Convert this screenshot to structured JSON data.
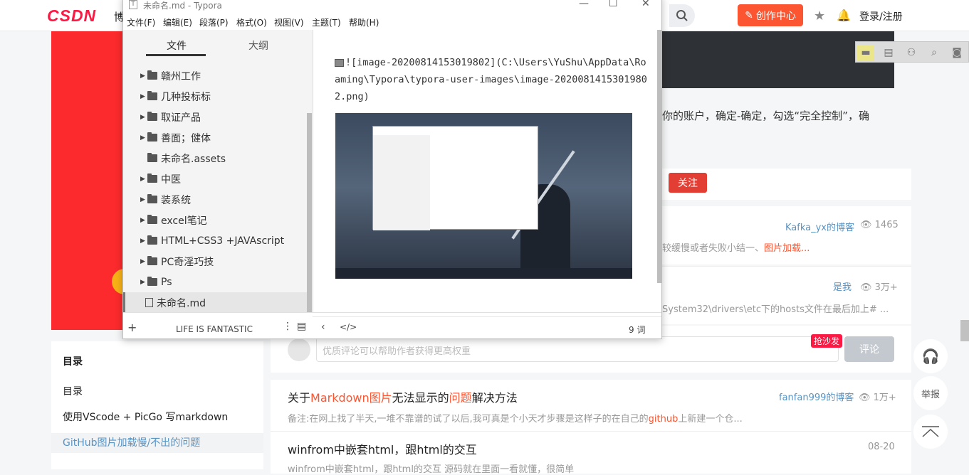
{
  "csdn": {
    "logo": "CSDN",
    "nav_partial": "博",
    "create_label": "创作中心",
    "login_label": "登录/注册"
  },
  "article": {
    "text_partial": "你的账户，确定-确定，勾选“完全控制”，确",
    "follow_label": "关注"
  },
  "recommendations": [
    {
      "blog": "Kafka_yx的博客",
      "views": "1465",
      "desc_plain": "较缓慢或者失败小结一、",
      "desc_red": "图片加载..."
    },
    {
      "blog": "是我",
      "views": "3万+",
      "desc_plain": "System32\\drivers\\etc下的hosts文件在最后加上# ..."
    },
    {
      "title_parts": [
        "关于",
        "Markdown",
        "图片",
        "无法显示的",
        "问题",
        "解决方法"
      ],
      "blog": "fanfan999的博客",
      "views": "1万+",
      "desc_a": "备注:在网上找了半天,一堆不靠谱的试了以后,我可真是个小天才步骤是这样子的在自己的",
      "desc_red": "github",
      "desc_b": "上新建一个仓..."
    },
    {
      "title": "winfrom中嵌套html，跟html的交互",
      "date": "08-20",
      "desc": "winfrom中嵌套html，跟html的交互 源码就在里面一看就懂，很简单"
    }
  ],
  "comment": {
    "placeholder": "优质评论可以帮助作者获得更高权重",
    "sofa": "抢沙发",
    "submit": "评论"
  },
  "toc": {
    "title": "目录",
    "items": [
      "目录",
      "使用VScode + PicGo 写markdown",
      "GitHub图片加载慢/不出的问题"
    ]
  },
  "side_tools": {
    "report": "举报"
  },
  "typora": {
    "title": "未命名.md - Typora",
    "menus": [
      "文件(F)",
      "编辑(E)",
      "段落(P)",
      "格式(O)",
      "视图(V)",
      "主题(T)",
      "帮助(H)"
    ],
    "tab_files": "文件",
    "tab_outline": "大纲",
    "files": [
      {
        "name": "赣州工作",
        "type": "folder"
      },
      {
        "name": "几种投标标",
        "type": "folder"
      },
      {
        "name": "取证产品",
        "type": "folder"
      },
      {
        "name": "善面；健体",
        "type": "folder"
      },
      {
        "name": "未命名.assets",
        "type": "folder-noarrow"
      },
      {
        "name": "中医",
        "type": "folder"
      },
      {
        "name": "装系统",
        "type": "folder"
      },
      {
        "name": "excel笔记",
        "type": "folder"
      },
      {
        "name": "HTML+CSS3 +JAVAscript",
        "type": "folder"
      },
      {
        "name": "PC奇淫巧技",
        "type": "folder"
      },
      {
        "name": "Ps",
        "type": "folder"
      },
      {
        "name": "未命名.md",
        "type": "file-active"
      }
    ],
    "footer_theme": "LIFE IS FANTASTIC",
    "markdown_source": "![image-20200814153019802](C:\\Users\\YuShu\\AppData\\Roaming\\Typora\\typora-user-images\\image-20200814153019802.png)",
    "word_count": "9 词"
  }
}
